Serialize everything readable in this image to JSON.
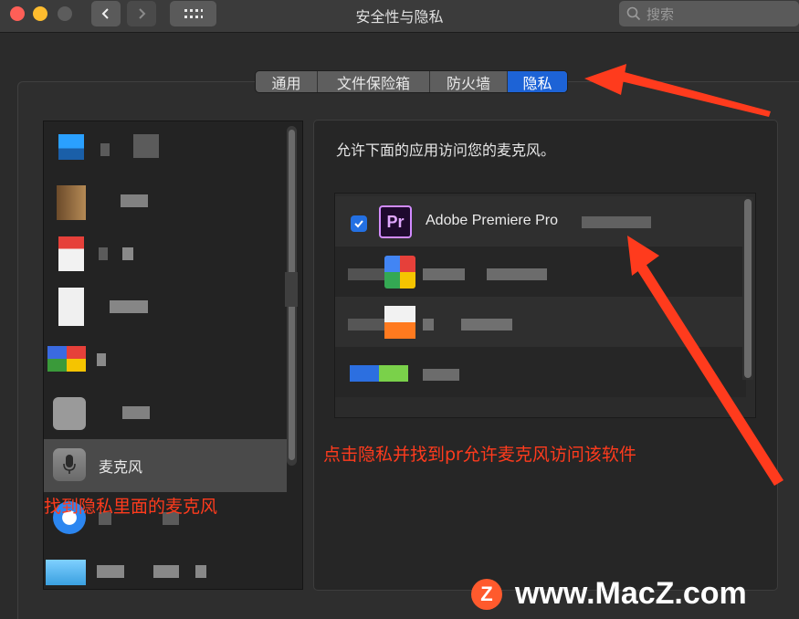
{
  "window": {
    "title": "安全性与隐私",
    "search_placeholder": "搜索"
  },
  "tabs": [
    {
      "label": "通用",
      "active": false
    },
    {
      "label": "文件保险箱",
      "active": false
    },
    {
      "label": "防火墙",
      "active": false
    },
    {
      "label": "隐私",
      "active": true
    }
  ],
  "sidebar": {
    "selected_item": {
      "label": "麦克风",
      "icon": "microphone-icon"
    }
  },
  "main": {
    "description": "允许下面的应用访问您的麦克风。",
    "apps": [
      {
        "name": "Adobe Premiere Pro",
        "icon_text": "Pr",
        "checked": true
      }
    ]
  },
  "annotations": {
    "right_note": "点击隐私并找到pr允许麦克风访问该软件",
    "left_note": "找到隐私里面的麦克风"
  },
  "watermark": {
    "logo_letter": "Z",
    "text": "www.MacZ.com"
  },
  "colors": {
    "accent": "#1d63d6",
    "annotation": "#ff3b1d"
  }
}
